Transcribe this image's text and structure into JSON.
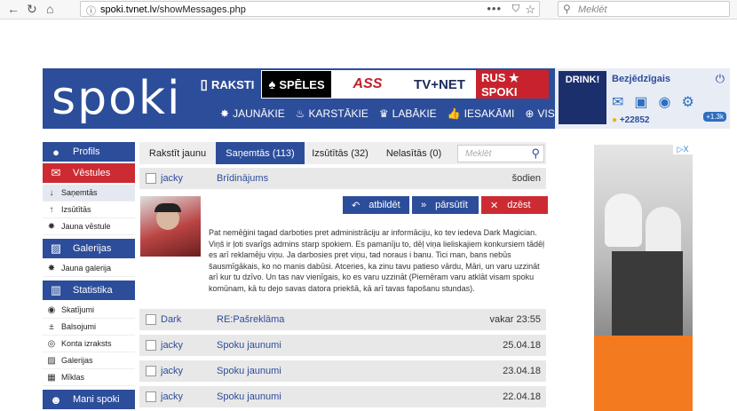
{
  "browser": {
    "url_prefix": "spoki.tvnet.lv",
    "url_path": "/showMessages.php",
    "search_placeholder": "Meklēt",
    "dots": "•••"
  },
  "header": {
    "logo": "spoki",
    "nav_top": [
      "RAKSTI",
      "SPĒLES",
      "ASS",
      "TV+NET",
      "RUS ★ SPOKI"
    ],
    "nav_bottom": [
      "JAUNĀKIE",
      "KARSTĀKIE",
      "LABĀKIE",
      "IESAKĀMI",
      "VISI"
    ],
    "user": {
      "name": "Bezjēdzīgais",
      "avatar_text": "DRINK!",
      "points": "+22852",
      "bubble": "+1.3k"
    }
  },
  "sidebar": {
    "profils": "Profils",
    "vestules": "Vēstules",
    "vestules_items": [
      "Saņemtās",
      "Izsūtītās",
      "Jauna vēstule"
    ],
    "galerijas": "Galerijas",
    "galerijas_items": [
      "Jauna galerija"
    ],
    "statistika": "Statistika",
    "statistika_items": [
      "Skatījumi",
      "Balsojumi",
      "Konta izraksts",
      "Galerijas",
      "Mīklas"
    ],
    "mani_spoki": "Mani spoki"
  },
  "tabs": {
    "items": [
      "Rakstīt jaunu",
      "Saņemtās (113)",
      "Izsūtītās (32)",
      "Nelasītās (0)"
    ],
    "active_index": 1,
    "search_placeholder": "Meklēt"
  },
  "messages": [
    {
      "from": "jacky",
      "subject": "Brīdinājums",
      "date": "šodien"
    },
    {
      "from": "Dark",
      "subject": "RE:Pašreklāma",
      "date": "vakar 23:55"
    },
    {
      "from": "jacky",
      "subject": "Spoku jaunumi",
      "date": "25.04.18"
    },
    {
      "from": "jacky",
      "subject": "Spoku jaunumi",
      "date": "23.04.18"
    },
    {
      "from": "jacky",
      "subject": "Spoku jaunumi",
      "date": "22.04.18"
    }
  ],
  "opened_message": {
    "actions": [
      "atbildēt",
      "pārsūtīt",
      "dzēst"
    ],
    "body": "Pat nemēģini tagad darboties pret administrāciju ar informāciju, ko tev iedeva Dark Magician. Viņš ir ļoti svarīgs admins starp spokiem. Es pamanīju to, dēļ viņa lieliskajiem konkursiem tādēļ es arī reklamēju viņu. Ja darbosies pret viņu, tad noraus i banu. Tici man, bans nebūs šausmīgākais, ko no manis dabūsi. Atceries, ka zinu tavu patieso vārdu, Māri, un varu uzzināt arī kur tu dzīvo. Un tas nav vienīgais, ko es varu uzzināt (Piemēram varu atklāt visam spoku komūnam, kā tu dejo savas datora priekšā, kā arī tavas fapošanu stundas)."
  },
  "ad": {
    "badge": "▷X"
  }
}
